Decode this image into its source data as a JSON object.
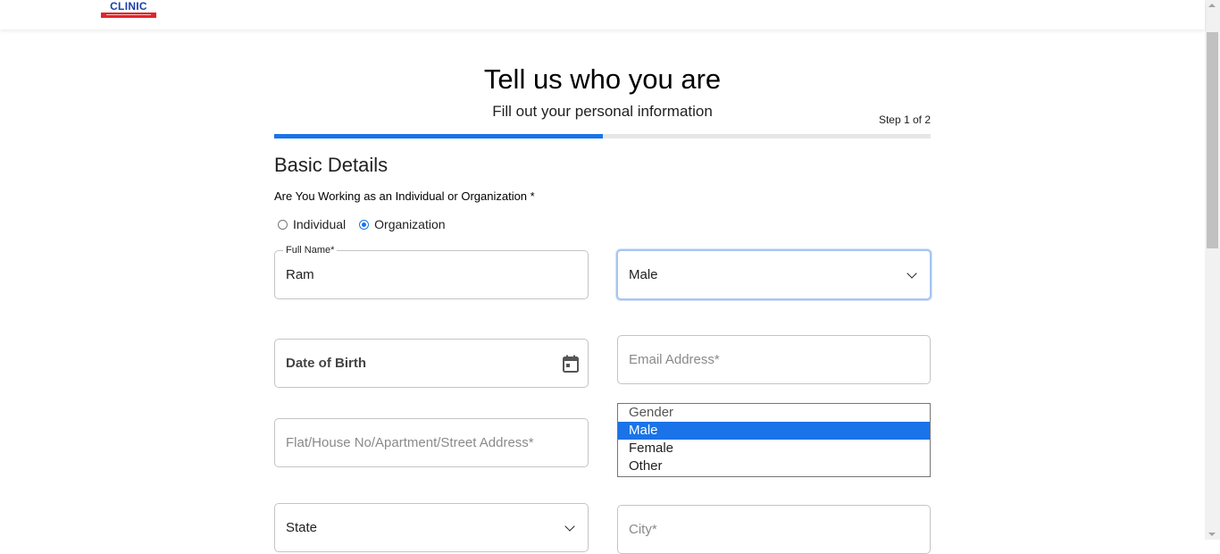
{
  "header": {
    "logo_text": "CLINIC",
    "logo_tagline": "A COMMITMENT TO EXCELLENCE"
  },
  "page": {
    "title": "Tell us who you are",
    "subtitle": "Fill out your personal information",
    "step_label": "Step 1 of 2",
    "progress_fraction": 0.5
  },
  "section": {
    "title": "Basic Details",
    "work_type_question": "Are You Working as an Individual or Organization *",
    "work_type_options": [
      {
        "label": "Individual",
        "selected": false
      },
      {
        "label": "Organization",
        "selected": true
      }
    ]
  },
  "form": {
    "full_name": {
      "legend": "Full Name*",
      "value": "Ram"
    },
    "gender_select": {
      "value": "Male"
    },
    "date_of_birth": {
      "label": "Date of Birth"
    },
    "email": {
      "placeholder": "Email Address*"
    },
    "address": {
      "placeholder": "Flat/House No/Apartment/Street Address*"
    },
    "state_select": {
      "value": "State"
    },
    "city": {
      "placeholder": "City*"
    }
  },
  "gender_dropdown": {
    "options": [
      "Gender",
      "Male",
      "Female",
      "Other"
    ],
    "highlighted": "Male"
  },
  "colors": {
    "accent": "#1a73e8",
    "progress_track": "#e6e6e6",
    "logo_blue": "#1a3fa8",
    "logo_red": "#e0262b"
  }
}
